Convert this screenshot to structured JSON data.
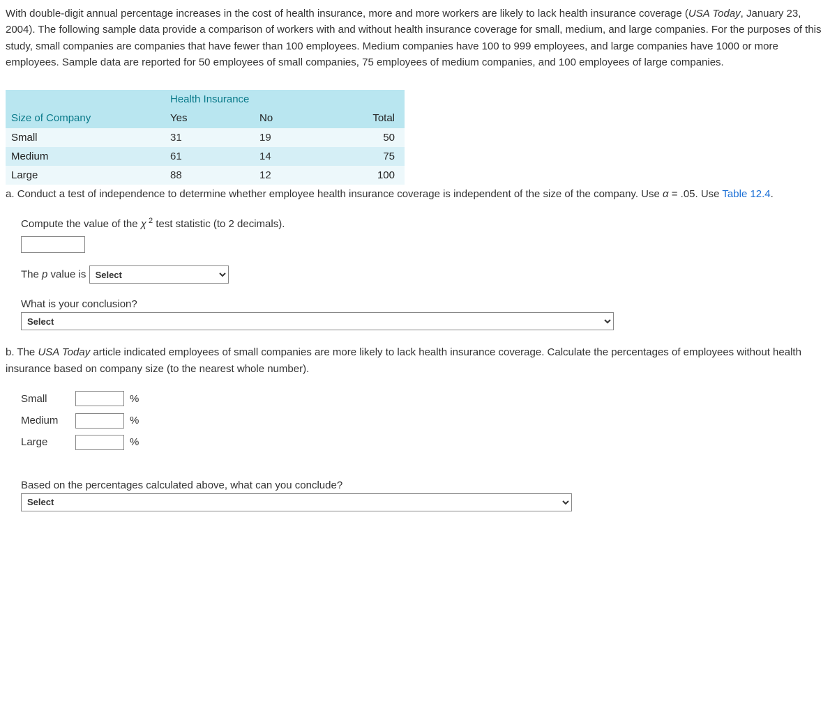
{
  "intro": {
    "p1_a": "With double-digit annual percentage increases in the cost of health insurance, more and more workers are likely to lack health insurance coverage (",
    "p1_cite": "USA Today",
    "p1_b": ", January 23, 2004). The following sample data provide a comparison of workers with and without health insurance coverage for small, medium, and large companies. For the purposes of this study, small companies are companies that have fewer than 100 employees. Medium companies have 100 to 999 employees, and large companies have 1000 or more employees. Sample data are reported for 50 employees of small companies, 75 employees of medium companies, and 100 employees of large companies."
  },
  "table": {
    "super_header": "Health Insurance",
    "col0": "Size of Company",
    "col1": "Yes",
    "col2": "No",
    "col3": "Total",
    "rows": [
      {
        "name": "Small",
        "yes": "31",
        "no": "19",
        "total": "50"
      },
      {
        "name": "Medium",
        "yes": "61",
        "no": "14",
        "total": "75"
      },
      {
        "name": "Large",
        "yes": "88",
        "no": "12",
        "total": "100"
      }
    ]
  },
  "partA": {
    "prefix": "a.",
    "text1_a": "Conduct a test of independence to determine whether employee health insurance coverage is independent of the size of the company. Use ",
    "alpha_sym": "α",
    "text1_b": " = .05. Use ",
    "link": "Table 12.4",
    "text1_c": ".",
    "compute_a": "Compute the value of the ",
    "chi_sym": "χ",
    "compute_b": " test statistic (to 2 decimals).",
    "pvalue_label": "The ",
    "p_sym": "p",
    "pvalue_label2": " value is",
    "select_placeholder": "Select",
    "conclusion_q": "What is your conclusion?"
  },
  "partB": {
    "prefix": "b.",
    "text_a": "The ",
    "cite": "USA Today",
    "text_b": " article indicated employees of small companies are more likely to lack health insurance coverage. Calculate the percentages of employees without health insurance based on company size (to the nearest whole number).",
    "rows": [
      {
        "label": "Small"
      },
      {
        "label": "Medium"
      },
      {
        "label": "Large"
      }
    ],
    "pct": "%",
    "conclude_q": "Based on the percentages calculated above, what can you conclude?",
    "select_placeholder": "Select"
  }
}
